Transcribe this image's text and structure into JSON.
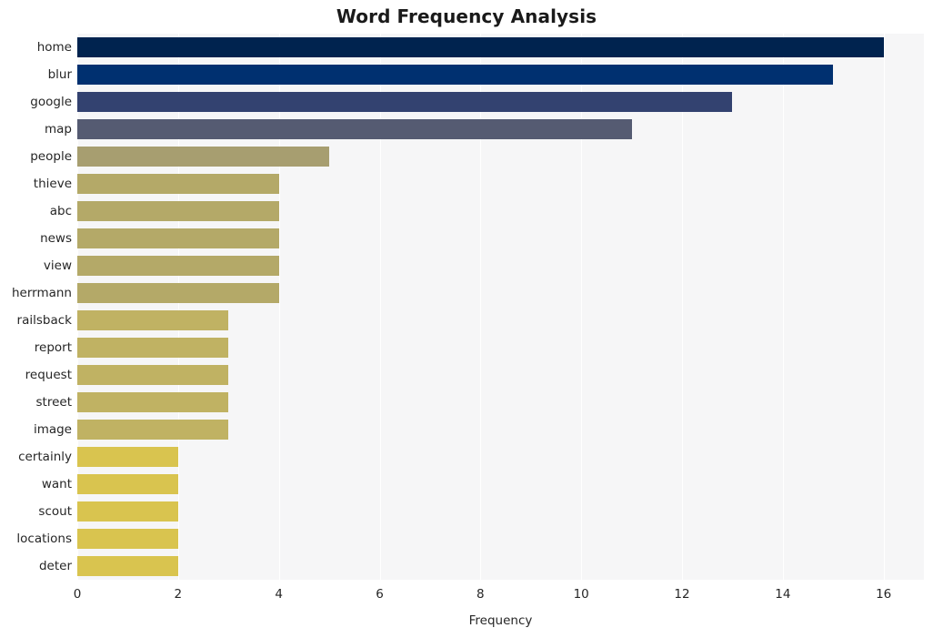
{
  "chart_data": {
    "type": "bar",
    "orientation": "horizontal",
    "title": "Word Frequency Analysis",
    "xlabel": "Frequency",
    "ylabel": "",
    "xlim": [
      0,
      16.8
    ],
    "ylim": [
      0,
      20
    ],
    "grid": true,
    "grid_axis": "x",
    "legend": false,
    "xticks": [
      "0",
      "2",
      "4",
      "6",
      "8",
      "10",
      "12",
      "14",
      "16"
    ],
    "xtick_values": [
      0,
      2,
      4,
      6,
      8,
      10,
      12,
      14,
      16
    ],
    "categories": [
      "home",
      "blur",
      "google",
      "map",
      "people",
      "thieve",
      "abc",
      "news",
      "view",
      "herrmann",
      "railsback",
      "report",
      "request",
      "street",
      "image",
      "certainly",
      "want",
      "scout",
      "locations",
      "deter"
    ],
    "values": [
      16,
      15,
      13,
      11,
      5,
      4,
      4,
      4,
      4,
      4,
      3,
      3,
      3,
      3,
      3,
      2,
      2,
      2,
      2,
      2
    ],
    "bar_colors": [
      "#00234f",
      "#003070",
      "#334270",
      "#555b72",
      "#a79e70",
      "#b4a968",
      "#b4a968",
      "#b4a968",
      "#b4a968",
      "#b4a968",
      "#c0b263",
      "#c0b263",
      "#c0b263",
      "#c0b263",
      "#c0b263",
      "#d9c44f",
      "#d9c44f",
      "#d9c44f",
      "#d9c44f",
      "#d9c44f"
    ],
    "plot_background": "#f6f6f7",
    "figure_background": "#ffffff",
    "gridline_color": "#ffffff",
    "title_color": "#1a1a1a",
    "tick_label_color": "#262626"
  }
}
